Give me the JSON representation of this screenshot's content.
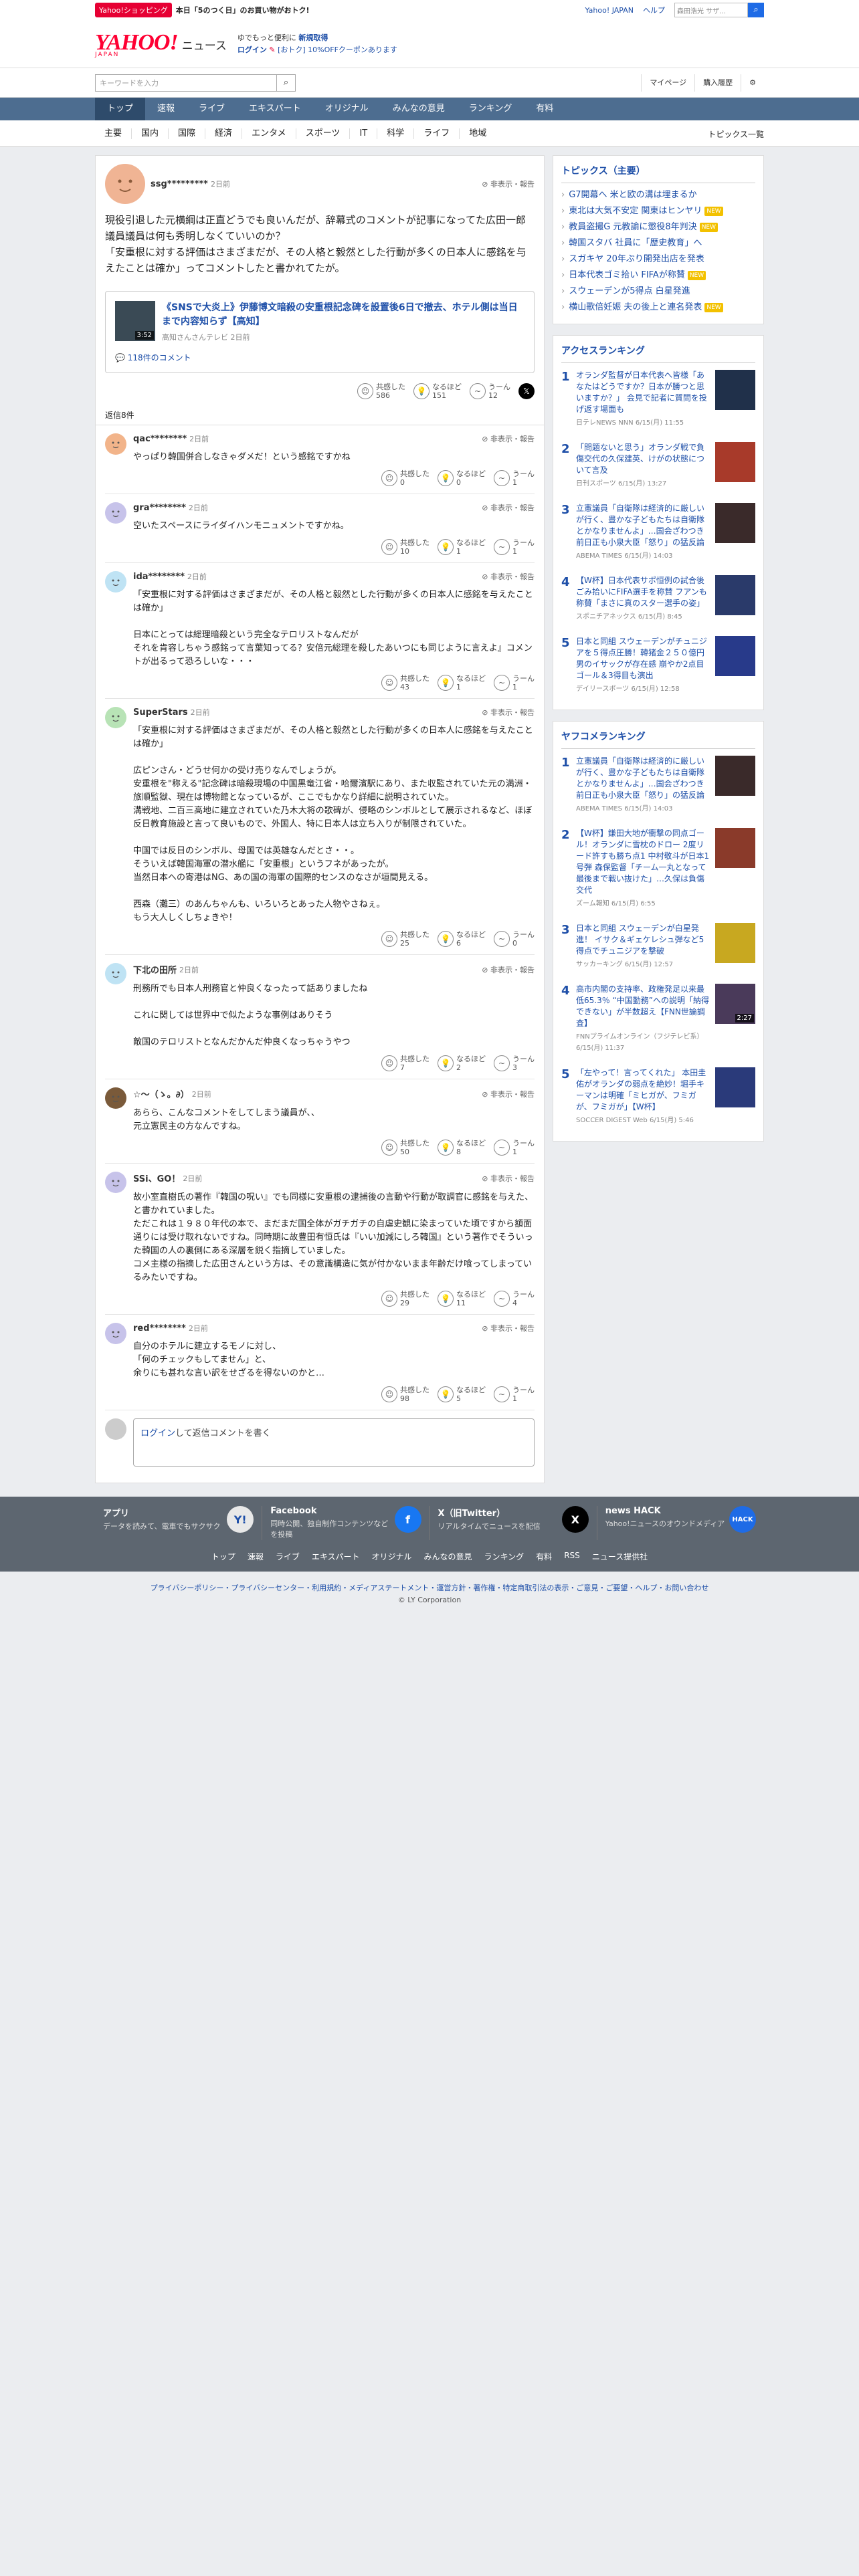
{
  "topstrip": {
    "shop_badge": "Yahoo!ショッピング",
    "promo": "本日「5のつく日」のお買い物がおトク!",
    "links": [
      "Yahoo! JAPAN",
      "ヘルプ"
    ],
    "websearch_placeholder": "ウェブ検索",
    "websearch_value": "森田浩光 サザ…"
  },
  "header": {
    "logo": "YAHOO!",
    "logo_sub": "JAPAN",
    "service": "ニュース",
    "info1_prefix": "ゆでもっと便利に",
    "info1_link": "新規取得",
    "info2_link": "ログイン",
    "info2_text": "[おトク] 10%OFFクーポンあります"
  },
  "search": {
    "placeholder": "キーワードを入力",
    "mypage": "マイページ",
    "history": "購入履歴"
  },
  "nav": [
    "トップ",
    "速報",
    "ライブ",
    "エキスパート",
    "オリジナル",
    "みんなの意見",
    "ランキング",
    "有料"
  ],
  "subnav": [
    "主要",
    "国内",
    "国際",
    "経済",
    "エンタメ",
    "スポーツ",
    "IT",
    "科学",
    "ライフ",
    "地域"
  ],
  "subnav_all": "トピックス一覧",
  "comment": {
    "user": "ssg*********",
    "time": "2日前",
    "report": "非表示・報告",
    "body": "現役引退した元横綱は正直どうでも良いんだが、辞幕式のコメントが記事になってた広田一郎議員議員は何も秀明しなくていいのか？\n「安重根に対する評価はさまざまだが、その人格と毅然とした行動が多くの日本人に感銘を与えたことは確か」ってコメントしたと書かれてたが。",
    "embed_title": "《SNSで大炎上》伊藤博文暗殺の安重根記念碑を設置後6日で撤去、ホテル側は当日まで内容知らず【高知】",
    "embed_source": "高知さんさんテレビ 2日前",
    "embed_duration": "3:52",
    "embed_comments": "118件のコメント",
    "reactions": [
      {
        "label": "共感した",
        "count": "586"
      },
      {
        "label": "なるほど",
        "count": "151"
      },
      {
        "label": "うーん",
        "count": "12"
      }
    ]
  },
  "replies_label": "返信8件",
  "replies": [
    {
      "user": "qac********",
      "time": "2日前",
      "report": "非表示・報告",
      "body": "やっぱり韓国併合しなきゃダメだ！という感銘ですかね",
      "counts": [
        "0",
        "0",
        "1"
      ],
      "color": "#f2b48a"
    },
    {
      "user": "gra********",
      "time": "2日前",
      "report": "非表示・報告",
      "body": "空いたスペースにライダイハンモニュメントですかね。",
      "counts": [
        "10",
        "1",
        "1"
      ],
      "color": "#c7c3ea"
    },
    {
      "user": "ida********",
      "time": "2日前",
      "report": "非表示・報告",
      "body": "「安重根に対する評価はさまざまだが、その人格と毅然とした行動が多くの日本人に感銘を与えたことは確か」\n\n日本にとっては総理暗殺という完全なテロリストなんだが\nそれを肯容しちゃう感銘って言葉知ってる？安倍元総理を殺したあいつにも同じように言えよ』コメントが出るって恐ろしいな・・・",
      "counts": [
        "43",
        "1",
        "1"
      ],
      "color": "#bfe3f4"
    },
    {
      "user": "SuperStars",
      "time": "2日前",
      "report": "非表示・報告",
      "body": "「安重根に対する評価はさまざまだが、その人格と毅然とした行動が多くの日本人に感銘を与えたことは確か」\n\n広ピンさん・どうせ何かの受け売りなんでしょうが。\n安重根を\"称える\"記念碑は暗殺現場の中国黒竜江省・哈爾濱駅にあり、また収監されていた元の満洲・旅順監獄、現在は博物館となっているが、ここでもかなり詳細に説明されていた。\n溝戦地、二百三高地に建立されていた乃木大将の歌碑が、侵略のシンボルとして展示されるなど、ほぼ反日教育施設と言って良いもので、外国人、特に日本人は立ち入りが制限されていた。\n\n中国では反日のシンボル、母国では英雄なんだとさ・・。\nそういえば韓国海軍の潜水艦に「安重根」というフネがあったが。\n当然日本への寄港はNG、あの国の海軍の国際的センスのなさが垣間見える。\n\n西森（灘三）のあんちゃんも、いろいろとあった人物やさねぇ。\nもう大人しくしちょきや！",
      "counts": [
        "25",
        "6",
        "0"
      ],
      "color": "#b8e3b6"
    },
    {
      "user": "下北の田所",
      "time": "2日前",
      "report": "非表示・報告",
      "body": "刑務所でも日本人刑務官と仲良くなったって話ありましたね\n\nこれに関しては世界中で似たような事例はありそう\n\n敵国のテロリストとなんだかんだ仲良くなっちゃうやつ",
      "counts": [
        "7",
        "2",
        "3"
      ],
      "color": "#bfe3f4"
    },
    {
      "user": "☆〜（ゝ。∂）",
      "time": "2日前",
      "report": "非表示・報告",
      "body": "あらら、こんなコメントをしてしまう議員が、、\n元立憲民主の方なんですね。",
      "counts": [
        "50",
        "8",
        "1"
      ],
      "color": "#7a5a3a"
    },
    {
      "user": "SSi、GO！",
      "time": "2日前",
      "report": "非表示・報告",
      "body": "故小室直樹氏の著作『韓国の呪い』でも同様に安重根の逮捕後の言動や行動が取調官に感銘を与えた、と書かれていました。\nただこれは１９８０年代の本で、まだまだ国全体がガチガチの自虐史観に染まっていた頃ですから額面通りには受け取れないですね。同時期に故豊田有恒氏は『いい加減にしろ韓国』という著作でそういった韓国の人の裏側にある深層を鋭く指摘していました。\nコメ主様の指摘した広田さんという方は、その意識構造に気が付かないまま年齢だけ喰ってしまっているみたいですね。",
      "counts": [
        "29",
        "11",
        "4"
      ],
      "color": "#c7c3ea"
    },
    {
      "user": "red********",
      "time": "2日前",
      "report": "非表示・報告",
      "body": "自分のホテルに建立するモノに対し、\n「何のチェックもしてません」と、\n余りにも甚れな言い訳をせざるを得ないのかと…",
      "counts": [
        "98",
        "5",
        "1"
      ],
      "color": "#c7c3ea"
    }
  ],
  "post_box": {
    "login_link": "ログイン",
    "text": "して返信コメントを書く"
  },
  "reaction_labels": [
    "共感した",
    "なるほど",
    "うーん"
  ],
  "topics": {
    "title": "トピックス（主要）",
    "items": [
      {
        "label": "G7開幕へ 米と欧の溝は埋まるか",
        "new": false
      },
      {
        "label": "東北は大気不安定 関東はヒンヤリ",
        "new": true
      },
      {
        "label": "教員盗撮G 元教諭に懲役8年判決",
        "new": true
      },
      {
        "label": "韓国スタバ 社員に「歴史教育」へ",
        "new": false
      },
      {
        "label": "スガキヤ 20年ぶり開発出店を発表",
        "new": false
      },
      {
        "label": "日本代表ゴミ拾い FIFAが称賛",
        "new": true
      },
      {
        "label": "スウェーデンが5得点 白星発進",
        "new": false
      },
      {
        "label": "横山歌倍妊娠 夫の後上と連名発表",
        "new": true
      }
    ],
    "new_label": "NEW"
  },
  "access_ranking": {
    "title": "アクセスランキング",
    "items": [
      {
        "num": "1",
        "text": "オランダ監督が日本代表へ皆様「あなたはどうですか？日本が勝つと思いますか？」 会見で記者に質問を投げ返す場面も",
        "meta": "日テレNEWS NNN 6/15(月) 11:55",
        "img": "#20304a",
        "dur": ""
      },
      {
        "num": "2",
        "text": "「問題ないと思う」オランダ戦で負傷交代の久保建英、けがの状態について言及",
        "meta": "日刊スポーツ 6/15(月) 13:27",
        "img": "#a83a2a",
        "dur": ""
      },
      {
        "num": "3",
        "text": "立憲議員「自衛隊は経済的に厳しいが行く、豊かな子どもたちは自衛隊とかなりませんよ」…国会ざわつき前日正も小泉大臣「怒り」の猛反論",
        "meta": "ABEMA TIMES 6/15(月) 14:03",
        "img": "#3a2a2a",
        "dur": ""
      },
      {
        "num": "4",
        "text": "【W杯】日本代表サポ恒例の試合後ごみ拾いにFIFA選手を称賛 フアンも称賛「まさに真のスター選手の姿」",
        "meta": "スポニチアネックス 6/15(月) 8:45",
        "img": "#2a3a6a",
        "dur": ""
      },
      {
        "num": "5",
        "text": "日本と同組 スウェーデンがチュニジアを５得点圧勝！韓猪金２５０億円男のイサックが存在感 崩やか2点目ゴール＆3得目も演出",
        "meta": "デイリースポーツ 6/15(月) 12:58",
        "img": "#283a8a",
        "dur": ""
      }
    ]
  },
  "yafoco_ranking": {
    "title": "ヤフコメランキング",
    "items": [
      {
        "num": "1",
        "text": "立憲議員「自衛隊は経済的に厳しいが行く、豊かな子どもたちは自衛隊とかなりませんよ」…国会ざわつき前日正も小泉大臣「怒り」の猛反論",
        "meta": "ABEMA TIMES 6/15(月) 14:03",
        "img": "#3a2a2a",
        "dur": ""
      },
      {
        "num": "2",
        "text": "【W杯】鎌田大地が衝撃の同点ゴール！オランダに雪枕のドロー 2度リード許すも勝ち点1 中村敬斗が日本1号弾 森保監督「チーム一丸となって最後まで戦い抜けた」…久保は負傷交代",
        "meta": "ズーム報知 6/15(月) 6:55",
        "img": "#8a3a2a",
        "dur": ""
      },
      {
        "num": "3",
        "text": "日本と同組 スウェーデンが白星発進！ イサク＆ギェケレシュ弾など5得点でチュニジアを撃破",
        "meta": "サッカーキング 6/15(月) 12:57",
        "img": "#c8a820",
        "dur": ""
      },
      {
        "num": "4",
        "text": "高市内閣の支持率、政権発足以来最低65.3％ “中国勤務”への説明「納得できない」が半数超え【FNN世論調査】",
        "meta": "FNNプライムオンライン（フジテレビ系） 6/15(月) 11:37",
        "img": "#4a3a5a",
        "dur": "2:27"
      },
      {
        "num": "5",
        "text": "「左やって！言ってくれた」 本田圭佑がオランダの弱点を絶妙！堀手キーマンは明確「ミヒガが、フミガが、フミガが」【W杯】",
        "meta": "SOCCER DIGEST Web 6/15(月) 5:46",
        "img": "#2a3a7a",
        "dur": ""
      }
    ]
  },
  "footer": {
    "apps": [
      {
        "title": "アプリ",
        "desc": "データを読みて、電車でもサクサク",
        "icon": "Y!",
        "color": "#e8e8e8"
      },
      {
        "title": "Facebook",
        "desc": "同時公開、独自制作コンテンツなどを投稿",
        "icon": "f",
        "color": "#1877f2"
      },
      {
        "title": "X（旧Twitter）",
        "desc": "リアルタイムでニュースを配信",
        "icon": "X",
        "color": "#000000"
      },
      {
        "title": "news HACK",
        "desc": "Yahoo!ニュースのオウンドメディア",
        "icon": "HACK",
        "color": "#1e6be6"
      }
    ],
    "links": [
      "トップ",
      "速報",
      "ライブ",
      "エキスパート",
      "オリジナル",
      "みんなの意見",
      "ランキング",
      "有料",
      "RSS",
      "ニュース提供社"
    ],
    "legal": "プライバシーポリシー・プライバシーセンター・利用規約・メディアステートメント・運営方針・著作権・特定商取引法の表示・ご意見・ご要望・ヘルプ・お問い合わせ",
    "copyright": "© LY Corporation"
  }
}
